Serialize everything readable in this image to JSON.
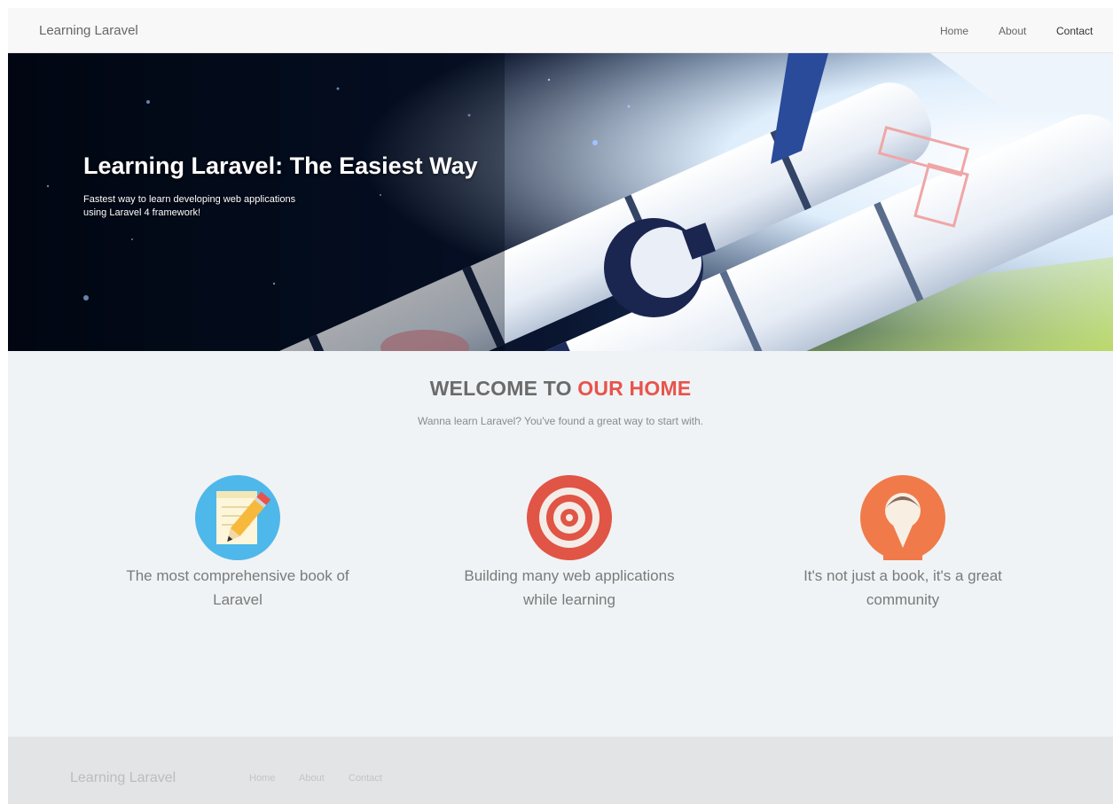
{
  "navbar": {
    "brand": "Learning Laravel",
    "links": [
      "Home",
      "About",
      "Contact"
    ]
  },
  "hero": {
    "title": "Learning Laravel: The Easiest Way",
    "subtitle_line1": "Fastest way to learn developing web applications",
    "subtitle_line2": "using Laravel 4 framework!"
  },
  "welcome": {
    "title_part1": "WELCOME TO ",
    "title_accent": "OUR HOME",
    "subtitle": "Wanna learn Laravel? You've found a great way to start with."
  },
  "features": [
    {
      "icon": "pencil-note-icon",
      "line1": "The most comprehensive book of",
      "line2": "Laravel"
    },
    {
      "icon": "target-icon",
      "line1": "Building many web applications",
      "line2": "while learning"
    },
    {
      "icon": "community-person-icon",
      "line1": "It's not just a book, it's a great",
      "line2": "community"
    }
  ],
  "footer": {
    "brand": "Learning Laravel",
    "links": [
      "Home",
      "About",
      "Contact"
    ]
  },
  "colors": {
    "accent": "#e8534b",
    "page_bg": "#f0f3f5",
    "footer_bg": "#e2e4e5"
  }
}
